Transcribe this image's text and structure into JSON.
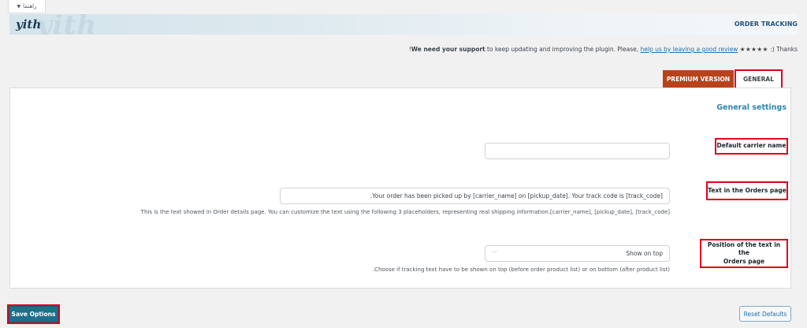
{
  "help_tab": {
    "label": "راهنما"
  },
  "banner": {
    "logo": "yith",
    "watermark": "yith",
    "title": "ORDER TRACKING"
  },
  "support": {
    "prefix": "!",
    "bold": "We need your support",
    "middle": " to keep updating and improving the plugin. Please, ",
    "link": "help us by leaving a good review",
    "stars": "★★★★★",
    "suffix": " :) Thanks"
  },
  "tabs": {
    "premium": "PREMIUM VERSION",
    "general": "GENERAL"
  },
  "section_title": "General settings",
  "fields": {
    "carrier": {
      "label": "Default carrier name",
      "value": ""
    },
    "orders_text": {
      "label": "Text in the Orders page",
      "value": ".Your order has been picked up by [carrier_name] on [pickup_date]. Your track code is [track_code]",
      "description": "This is the text showed in Order details page. You can customize the text using the following 3 placeholders, representing real shipping information.[carrier_name], [pickup_date], [track_code]"
    },
    "position": {
      "label_line1": "Position of the text in the",
      "label_line2": "Orders page",
      "value": "Show on top",
      "description": ".Choose if tracking text have to be shown on top (before order product list) or on bottom (after product list)"
    }
  },
  "buttons": {
    "save": "Save Options",
    "reset": "Reset Defaults"
  },
  "colors": {
    "highlight": "#e0001b",
    "premium": "#b8431b",
    "save": "#1d6f8c",
    "title": "#2c86b3"
  }
}
